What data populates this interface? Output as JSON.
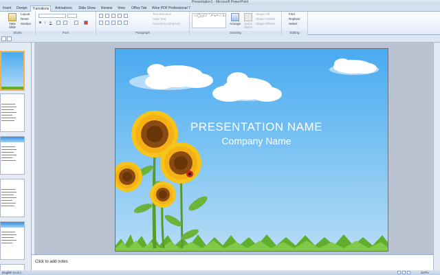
{
  "window": {
    "title": "Presentation1 - Microsoft PowerPoint"
  },
  "tabs": [
    "Insert",
    "Design",
    "Transitions",
    "Animations",
    "Slide Show",
    "Review",
    "View",
    "Office Tab",
    "Wine PDF Professional 7"
  ],
  "active_tab": "Transitions",
  "ribbon": {
    "slides": {
      "label": "Slides",
      "new_slide": "New Slide",
      "layout": "Layout",
      "reset": "Reset",
      "section": "Section"
    },
    "font": {
      "label": "Font"
    },
    "paragraph": {
      "label": "Paragraph",
      "text_direction": "Text Direction",
      "align_text": "Align Text",
      "convert_smartart": "Convert to SmartArt"
    },
    "drawing": {
      "label": "Drawing",
      "arrange": "Arrange",
      "quick_styles": "Quick Styles",
      "shape_fill": "Shape Fill",
      "shape_outline": "Shape Outline",
      "shape_effects": "Shape Effects"
    },
    "editing": {
      "label": "Editing",
      "find": "Find",
      "replace": "Replace",
      "select": "Select"
    }
  },
  "slide": {
    "title": "PRESENTATION  NAME",
    "subtitle": "Company Name"
  },
  "notes": {
    "placeholder": "Click to add notes"
  },
  "status": {
    "language": "English (U.S.)",
    "zoom": "107%"
  },
  "colors": {
    "sky_top": "#4aaaf0",
    "sky_bottom": "#b6dcf7",
    "grass": "#5fae2e",
    "sunflower": "#f6c41a"
  }
}
